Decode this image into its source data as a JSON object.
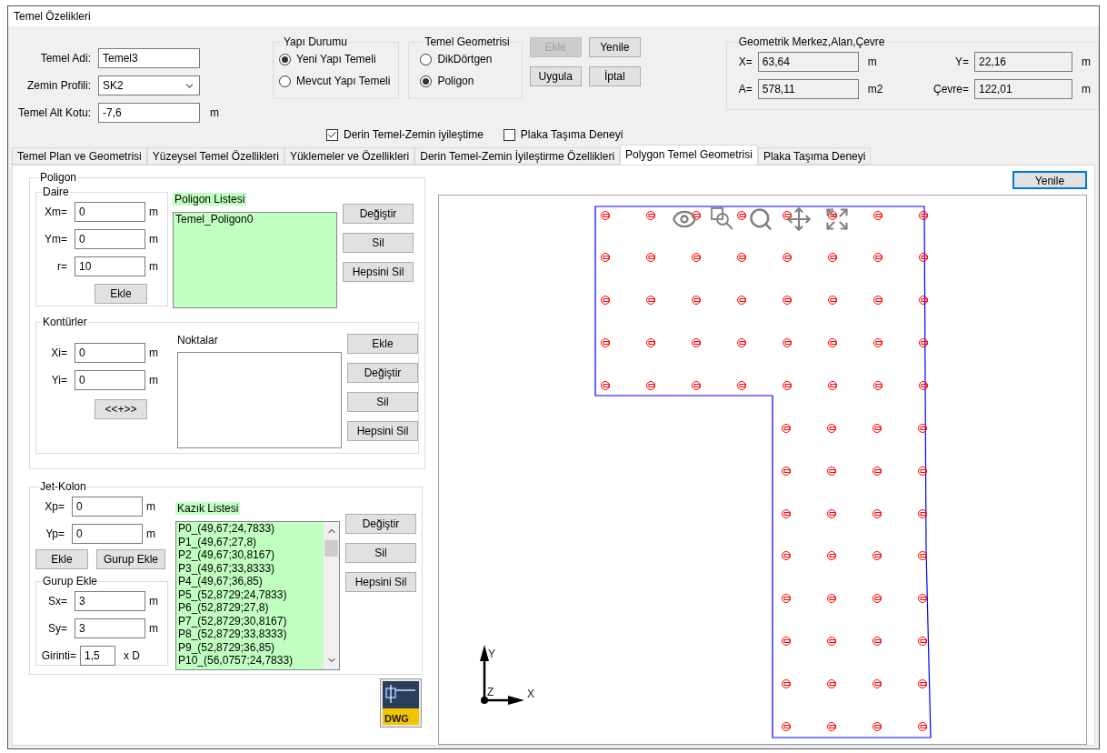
{
  "window": {
    "title": "Temel Özelikleri"
  },
  "header_fields": [
    {
      "label": "Temel Adi:",
      "value": "Temel3",
      "kind": "text"
    },
    {
      "label": "Zemin Profili:",
      "value": "SK2",
      "kind": "dropdown"
    },
    {
      "label": "Temel Alt Kotu:",
      "value": "-7,6",
      "unit": "m",
      "kind": "text"
    }
  ],
  "yapi_durumu": {
    "title": "Yapı Durumu",
    "options": [
      {
        "label": "Yeni Yapı Temeli",
        "selected": true
      },
      {
        "label": "Mevcut Yapı Temeli",
        "selected": false
      }
    ]
  },
  "temel_geometrisi": {
    "title": "Temel Geometrisi",
    "options": [
      {
        "label": "DikDörtgen",
        "selected": false
      },
      {
        "label": "Poligon",
        "selected": true
      }
    ]
  },
  "action_buttons": [
    {
      "label": "Ekle",
      "disabled": true
    },
    {
      "label": "Yenile",
      "disabled": false
    },
    {
      "label": "Uygula",
      "disabled": false
    },
    {
      "label": "İptal",
      "disabled": false
    }
  ],
  "checkboxes": [
    {
      "label": "Derin Temel-Zemin iyileştime",
      "checked": true
    },
    {
      "label": "Plaka Taşıma Deneyi",
      "checked": false
    }
  ],
  "geometrik_merkez": {
    "title": "Geometrik Merkez,Alan,Çevre",
    "fields": [
      {
        "label": "X=",
        "value": "63,64",
        "unit": "m"
      },
      {
        "label": "Y=",
        "value": "22,16",
        "unit": "m"
      },
      {
        "label": "A=",
        "value": "578,11",
        "unit": "m2"
      },
      {
        "label": "Çevre=",
        "value": "122,01",
        "unit": "m"
      }
    ]
  },
  "tabs": [
    {
      "label": "Temel Plan ve Geometrisi",
      "selected": false
    },
    {
      "label": "Yüzeysel Temel Özellikleri",
      "selected": false
    },
    {
      "label": "Yüklemeler ve Özellikleri",
      "selected": false
    },
    {
      "label": "Derin Temel-Zemin İyileştirme Özellikleri",
      "selected": false
    },
    {
      "label": "Polygon Temel Geometrisi",
      "selected": true
    },
    {
      "label": "Plaka Taşıma Deneyi",
      "selected": false
    }
  ],
  "refresh_button": "Yenile",
  "poligon": {
    "title": "Poligon",
    "daire": {
      "title": "Daire",
      "fields": [
        {
          "label": "Xm=",
          "value": "0",
          "unit": "m"
        },
        {
          "label": "Ym=",
          "value": "0",
          "unit": "m"
        },
        {
          "label": "r=",
          "value": "10",
          "unit": "m"
        }
      ],
      "button": "Ekle"
    },
    "list_title": "Poligon Listesi",
    "list_items": [
      "Temel_Poligon0"
    ],
    "buttons": [
      "Değiştir",
      "Sil",
      "Hepsini Sil"
    ]
  },
  "konturler": {
    "title": "Kontürler",
    "fields": [
      {
        "label": "Xi=",
        "value": "0",
        "unit": "m"
      },
      {
        "label": "Yi=",
        "value": "0",
        "unit": "m"
      }
    ],
    "button": "<<+>>",
    "list_title": "Noktalar",
    "buttons": [
      "Ekle",
      "Değiştir",
      "Sil",
      "Hepsini Sil"
    ]
  },
  "jet_kolon": {
    "title": "Jet-Kolon",
    "fields": [
      {
        "label": "Xp=",
        "value": "0",
        "unit": "m"
      },
      {
        "label": "Yp=",
        "value": "0",
        "unit": "m"
      }
    ],
    "buttons_left": [
      "Ekle",
      "Gurup Ekle"
    ],
    "gurup_ekle": {
      "title": "Gurup Ekle",
      "fields": [
        {
          "label": "Sx=",
          "value": "3",
          "unit": "m"
        },
        {
          "label": "Sy=",
          "value": "3",
          "unit": "m"
        }
      ],
      "girinti": {
        "label": "Girinti=",
        "value": "1,5",
        "unit": "x D"
      }
    },
    "list_title": "Kazık Listesi",
    "list_items": [
      "P0_(49,67;24,7833)",
      "P1_(49,67;27,8)",
      "P2_(49,67;30,8167)",
      "P3_(49,67;33,8333)",
      "P4_(49,67;36,85)",
      "P5_(52,8729;24,7833)",
      "P6_(52,8729;27,8)",
      "P7_(52,8729;30,8167)",
      "P8_(52,8729;33,8333)",
      "P9_(52,8729;36,85)",
      "P10_(56,0757;24,7833)"
    ],
    "buttons": [
      "Değiştir",
      "Sil",
      "Hepsini Sil"
    ]
  },
  "dwg_label": "DWG",
  "canvas": {
    "axes": [
      "X",
      "Y",
      "Z"
    ]
  }
}
